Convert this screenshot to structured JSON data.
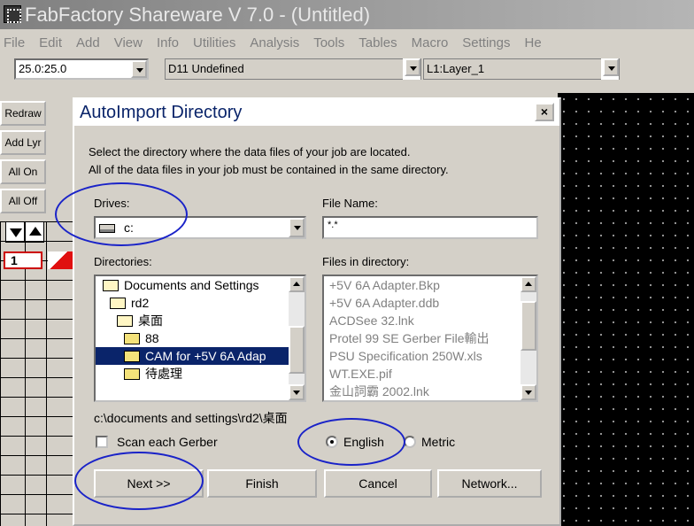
{
  "app": {
    "title": "FabFactory Shareware V 7.0 - (Untitled)"
  },
  "menu": [
    "File",
    "Edit",
    "Add",
    "View",
    "Info",
    "Utilities",
    "Analysis",
    "Tools",
    "Tables",
    "Macro",
    "Settings",
    "He"
  ],
  "toolbar": {
    "zoom": "25.0:25.0",
    "dcode": "D11  Undefined",
    "layer": "L1:Layer_1"
  },
  "side_buttons": [
    "Redraw",
    "Add Lyr",
    "All On",
    "All Off"
  ],
  "layer_number": "1",
  "dialog": {
    "title": "AutoImport Directory",
    "close": "×",
    "instruction1": "Select the directory where the data files of your job are located.",
    "instruction2": "All of the data files in your job must be contained in the same directory.",
    "drives_label": "Drives:",
    "drive_value": "c:",
    "filename_label": "File Name:",
    "filename_value": "*.*",
    "directories_label": "Directories:",
    "directories": [
      "Documents and Settings",
      "rd2",
      "桌面",
      "88",
      "CAM for +5V 6A Adap",
      "待處理"
    ],
    "files_label": "Files in directory:",
    "files": [
      "+5V 6A Adapter.Bkp",
      "+5V 6A Adapter.ddb",
      "ACDSee 32.lnk",
      "Protel 99 SE Gerber File輸出",
      "PSU Specification 250W.xls",
      "WT.EXE.pif",
      "金山詞霸 2002.lnk"
    ],
    "current_path": "c:\\documents and settings\\rd2\\桌面",
    "scan_label": "Scan each Gerber",
    "english_label": "English",
    "metric_label": "Metric",
    "buttons": {
      "next": "Next >>",
      "finish": "Finish",
      "cancel": "Cancel",
      "network": "Network..."
    }
  },
  "colors": {
    "annotation_ring": "#1a23c8",
    "selection": "#0a246a",
    "dialog_title": "#0a246a"
  }
}
